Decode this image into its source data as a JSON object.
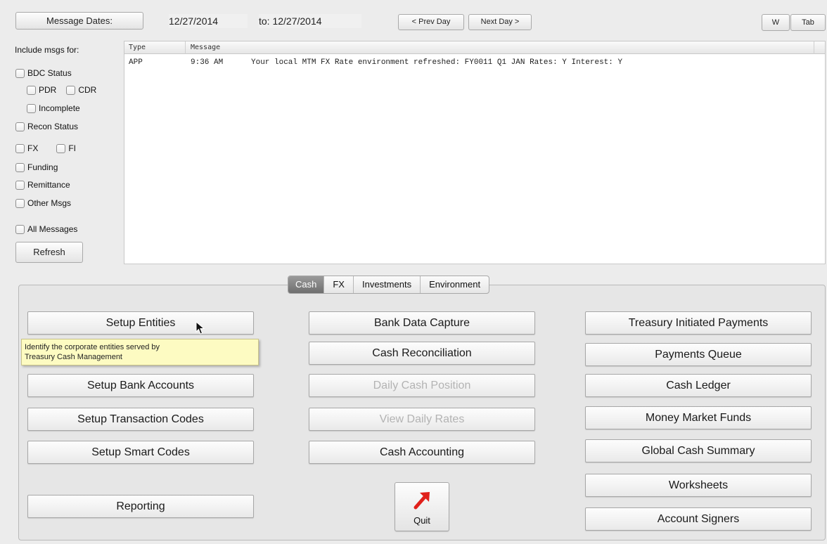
{
  "topbar": {
    "message_dates_label": "Message Dates:",
    "from_date": "12/27/2014",
    "to_label": "to:",
    "to_date": "12/27/2014",
    "prev_day": "< Prev Day",
    "next_day": "Next Day >",
    "w_button": "W",
    "tab_button": "Tab"
  },
  "filters": {
    "heading": "Include msgs for:",
    "bdc_status": "BDC Status",
    "pdr": "PDR",
    "cdr": "CDR",
    "incomplete": "Incomplete",
    "recon_status": "Recon Status",
    "fx": "FX",
    "fi": "FI",
    "funding": "Funding",
    "remittance": "Remittance",
    "other_msgs": "Other Msgs",
    "all_messages": "All Messages",
    "refresh": "Refresh"
  },
  "messages": {
    "columns": [
      "Type",
      "Message"
    ],
    "rows": [
      {
        "type": "APP",
        "time": "9:36 AM",
        "text": "Your local MTM FX Rate environment refreshed: FY0011 Q1 JAN  Rates: Y Interest: Y"
      }
    ]
  },
  "tabs": [
    "Cash",
    "FX",
    "Investments",
    "Environment"
  ],
  "active_tab": "Cash",
  "cash": {
    "left": [
      "Setup Entities",
      "Setup Bank Accounts",
      "Setup Transaction Codes",
      "Setup Smart Codes",
      "Reporting"
    ],
    "middle": [
      "Bank Data Capture",
      "Cash Reconciliation",
      "Daily Cash Position",
      "View Daily Rates",
      "Cash Accounting"
    ],
    "right": [
      "Treasury Initiated Payments",
      "Payments Queue",
      "Cash Ledger",
      "Money Market Funds",
      "Global Cash Summary",
      "Worksheets",
      "Account Signers"
    ],
    "disabled": [
      "Daily Cash Position",
      "View Daily Rates"
    ],
    "quit": "Quit"
  },
  "tooltip": {
    "line1": "Identify the corporate entities served by",
    "line2": "Treasury Cash Management"
  },
  "colors": {
    "quit_arrow": "#e0201b",
    "tooltip_bg": "#fdfbc2",
    "active_tab": "#7f7f7f"
  }
}
